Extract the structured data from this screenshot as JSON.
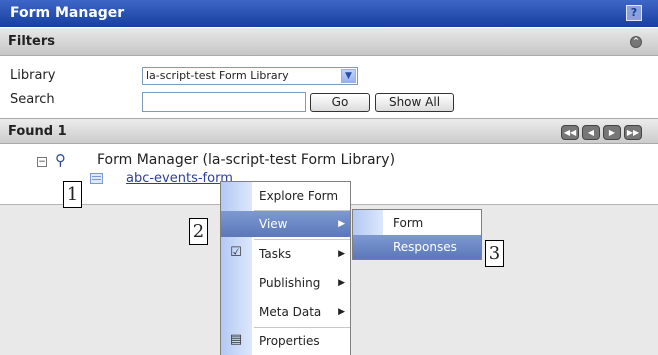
{
  "app": {
    "title": "Form Manager"
  },
  "filters": {
    "title": "Filters",
    "library_label": "Library",
    "library_value": "la-script-test Form Library",
    "search_label": "Search",
    "search_value": "",
    "go_label": "Go",
    "show_all_label": "Show All"
  },
  "results": {
    "found_label": "Found 1",
    "pager": [
      "first",
      "previous",
      "next",
      "last"
    ]
  },
  "tree": {
    "root_label": "Form Manager (la-script-test Form Library)",
    "root_toggle": "−",
    "item_label": "abc-events-form"
  },
  "context_menu": {
    "items": [
      {
        "label": "Explore Form"
      },
      {
        "label": "View",
        "submenu": true,
        "highlighted": true
      },
      {
        "label": "Tasks",
        "submenu": true,
        "icon": "clipboard-icon"
      },
      {
        "label": "Publishing",
        "submenu": true
      },
      {
        "label": "Meta Data",
        "submenu": true
      },
      {
        "label": "Properties",
        "icon": "properties-icon"
      }
    ]
  },
  "view_submenu": {
    "items": [
      {
        "label": "Form"
      },
      {
        "label": "Responses",
        "highlighted": true
      }
    ]
  },
  "callouts": [
    "1",
    "2",
    "3"
  ],
  "colors": {
    "title_bar": "#163f9f",
    "menu_highlight": "#5b77b8",
    "link": "#2c3f9c"
  }
}
